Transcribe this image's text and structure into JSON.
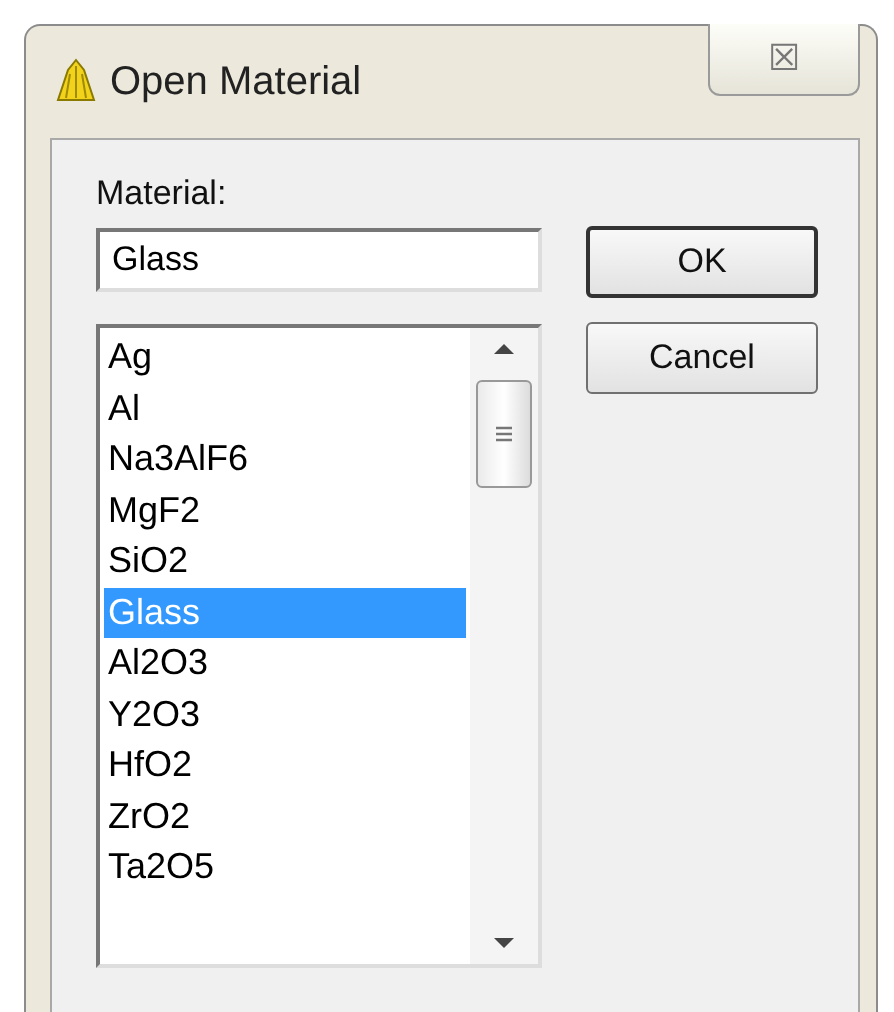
{
  "window": {
    "title": "Open Material",
    "close_symbol": "☒"
  },
  "material_label": "Material:",
  "material_field": {
    "value": "Glass"
  },
  "materials": [
    {
      "name": "Ag",
      "selected": false
    },
    {
      "name": "Al",
      "selected": false
    },
    {
      "name": "Na3AlF6",
      "selected": false
    },
    {
      "name": "MgF2",
      "selected": false
    },
    {
      "name": "SiO2",
      "selected": false
    },
    {
      "name": "Glass",
      "selected": true
    },
    {
      "name": "Al2O3",
      "selected": false
    },
    {
      "name": "Y2O3",
      "selected": false
    },
    {
      "name": "HfO2",
      "selected": false
    },
    {
      "name": "ZrO2",
      "selected": false
    },
    {
      "name": "Ta2O5",
      "selected": false
    }
  ],
  "buttons": [
    "OK",
    "Cancel"
  ]
}
